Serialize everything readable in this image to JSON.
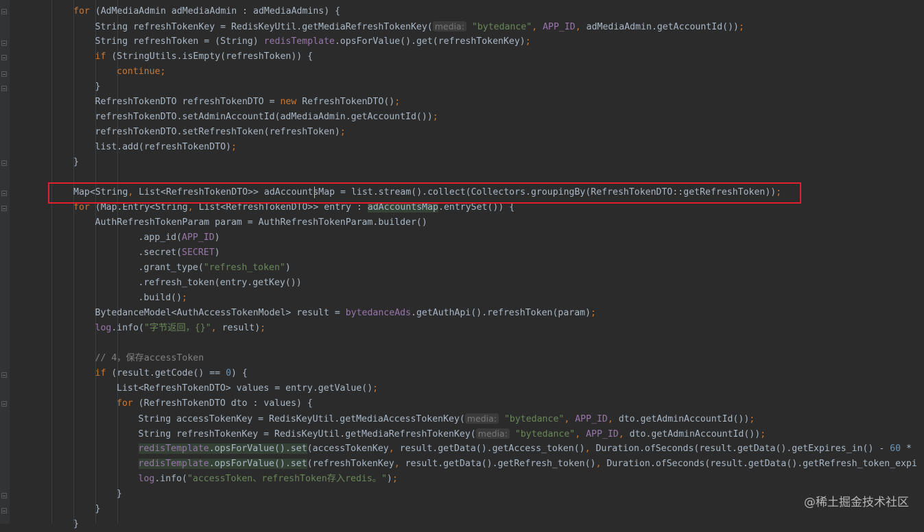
{
  "code_lines": [
    {
      "indent": 2,
      "segs": [
        [
          "kw",
          "for"
        ],
        [
          "plain",
          " (AdMediaAdmin adMediaAdmin : adMediaAdmins) {"
        ]
      ]
    },
    {
      "indent": 3,
      "segs": [
        [
          "plain",
          "String refreshTokenKey = RedisKeyUtil.getMediaRefreshTokenKey("
        ],
        [
          "hint",
          "media:"
        ],
        [
          "plain",
          " "
        ],
        [
          "str",
          "\"bytedance\""
        ],
        [
          "punc",
          ", "
        ],
        [
          "field",
          "APP_ID"
        ],
        [
          "punc",
          ", "
        ],
        [
          "plain",
          "adMediaAdmin.getAccountId())"
        ],
        [
          "punc",
          ";"
        ]
      ]
    },
    {
      "indent": 3,
      "segs": [
        [
          "plain",
          "String refreshToken = (String) "
        ],
        [
          "field",
          "redisTemplate"
        ],
        [
          "plain",
          ".opsForValue().get(refreshTokenKey)"
        ],
        [
          "punc",
          ";"
        ]
      ]
    },
    {
      "indent": 3,
      "segs": [
        [
          "kw",
          "if"
        ],
        [
          "plain",
          " (StringUtils.isEmpty(refreshToken)) {"
        ]
      ]
    },
    {
      "indent": 4,
      "segs": [
        [
          "kw",
          "continue;"
        ]
      ]
    },
    {
      "indent": 3,
      "segs": [
        [
          "plain",
          "}"
        ]
      ]
    },
    {
      "indent": 3,
      "segs": [
        [
          "plain",
          "RefreshTokenDTO refreshTokenDTO = "
        ],
        [
          "kw",
          "new"
        ],
        [
          "plain",
          " RefreshTokenDTO()"
        ],
        [
          "punc",
          ";"
        ]
      ]
    },
    {
      "indent": 3,
      "segs": [
        [
          "plain",
          "refreshTokenDTO.setAdminAccountId(adMediaAdmin.getAccountId())"
        ],
        [
          "punc",
          ";"
        ]
      ]
    },
    {
      "indent": 3,
      "segs": [
        [
          "plain",
          "refreshTokenDTO.setRefreshToken(refreshToken)"
        ],
        [
          "punc",
          ";"
        ]
      ]
    },
    {
      "indent": 3,
      "segs": [
        [
          "plain",
          "list.add(refreshTokenDTO)"
        ],
        [
          "punc",
          ";"
        ]
      ]
    },
    {
      "indent": 2,
      "segs": [
        [
          "plain",
          "}"
        ]
      ]
    },
    {
      "indent": 0,
      "segs": []
    },
    {
      "indent": 2,
      "segs": [
        [
          "plain",
          "Map<String"
        ],
        [
          "punc",
          ", "
        ],
        [
          "plain",
          "List<RefreshTokenDTO>> adAccountsMap = list.stream().collect(Collectors.groupingBy(RefreshTokenDTO::getRefreshToken))"
        ],
        [
          "punc",
          ";"
        ]
      ]
    },
    {
      "indent": 2,
      "segs": [
        [
          "kw",
          "for"
        ],
        [
          "plain",
          " (Map.Entry<String"
        ],
        [
          "punc",
          ", "
        ],
        [
          "plain",
          "List<RefreshTokenDTO>> entry : "
        ],
        [
          "hl",
          "adAccountsMap"
        ],
        [
          "plain",
          ".entrySet()) {"
        ]
      ]
    },
    {
      "indent": 3,
      "segs": [
        [
          "plain",
          "AuthRefreshTokenParam param = AuthRefreshTokenParam.builder()"
        ]
      ]
    },
    {
      "indent": 5,
      "segs": [
        [
          "plain",
          ".app_id("
        ],
        [
          "field",
          "APP_ID"
        ],
        [
          "plain",
          ")"
        ]
      ]
    },
    {
      "indent": 5,
      "segs": [
        [
          "plain",
          ".secret("
        ],
        [
          "field",
          "SECRET"
        ],
        [
          "plain",
          ")"
        ]
      ]
    },
    {
      "indent": 5,
      "segs": [
        [
          "plain",
          ".grant_type("
        ],
        [
          "str",
          "\"refresh_token\""
        ],
        [
          "plain",
          ")"
        ]
      ]
    },
    {
      "indent": 5,
      "segs": [
        [
          "plain",
          ".refresh_token(entry.getKey())"
        ]
      ]
    },
    {
      "indent": 5,
      "segs": [
        [
          "plain",
          ".build()"
        ],
        [
          "punc",
          ";"
        ]
      ]
    },
    {
      "indent": 3,
      "segs": [
        [
          "plain",
          "BytedanceModel<AuthAccessTokenModel> result = "
        ],
        [
          "field",
          "bytedanceAds"
        ],
        [
          "plain",
          ".getAuthApi().refreshToken(param)"
        ],
        [
          "punc",
          ";"
        ]
      ]
    },
    {
      "indent": 3,
      "segs": [
        [
          "field",
          "log"
        ],
        [
          "plain",
          ".info("
        ],
        [
          "str",
          "\"字节返回，{}\""
        ],
        [
          "punc",
          ", "
        ],
        [
          "plain",
          "result)"
        ],
        [
          "punc",
          ";"
        ]
      ]
    },
    {
      "indent": 0,
      "segs": []
    },
    {
      "indent": 3,
      "segs": [
        [
          "cmt",
          "// 4，保存accessToken"
        ]
      ]
    },
    {
      "indent": 3,
      "segs": [
        [
          "kw",
          "if"
        ],
        [
          "plain",
          " (result.getCode() == "
        ],
        [
          "num",
          "0"
        ],
        [
          "plain",
          ") {"
        ]
      ]
    },
    {
      "indent": 4,
      "segs": [
        [
          "plain",
          "List<RefreshTokenDTO> values = entry.getValue()"
        ],
        [
          "punc",
          ";"
        ]
      ]
    },
    {
      "indent": 4,
      "segs": [
        [
          "kw",
          "for"
        ],
        [
          "plain",
          " (RefreshTokenDTO dto : values) {"
        ]
      ]
    },
    {
      "indent": 5,
      "segs": [
        [
          "plain",
          "String accessTokenKey = RedisKeyUtil.getMediaAccessTokenKey("
        ],
        [
          "hint",
          "media:"
        ],
        [
          "plain",
          " "
        ],
        [
          "str",
          "\"bytedance\""
        ],
        [
          "punc",
          ", "
        ],
        [
          "field",
          "APP_ID"
        ],
        [
          "punc",
          ", "
        ],
        [
          "plain",
          "dto.getAdminAccountId())"
        ],
        [
          "punc",
          ";"
        ]
      ]
    },
    {
      "indent": 5,
      "segs": [
        [
          "plain",
          "String refreshTokenKey = RedisKeyUtil.getMediaRefreshTokenKey("
        ],
        [
          "hint",
          "media:"
        ],
        [
          "plain",
          " "
        ],
        [
          "str",
          "\"bytedance\""
        ],
        [
          "punc",
          ", "
        ],
        [
          "field",
          "APP_ID"
        ],
        [
          "punc",
          ", "
        ],
        [
          "plain",
          "dto.getAdminAccountId())"
        ],
        [
          "punc",
          ";"
        ]
      ]
    },
    {
      "indent": 5,
      "segs": [
        [
          "hlf",
          "redisTemplate"
        ],
        [
          "hl",
          ".opsForValue().set"
        ],
        [
          "plain",
          "(accessTokenKey"
        ],
        [
          "punc",
          ", "
        ],
        [
          "plain",
          "result.getData().getAccess_token()"
        ],
        [
          "punc",
          ", "
        ],
        [
          "plain",
          "Duration.ofSeconds(result.getData().getExpires_in() - "
        ],
        [
          "num",
          "60"
        ],
        [
          "plain",
          " *"
        ]
      ]
    },
    {
      "indent": 5,
      "segs": [
        [
          "hlf",
          "redisTemplate"
        ],
        [
          "hl",
          ".opsForValue().set"
        ],
        [
          "plain",
          "(refreshTokenKey"
        ],
        [
          "punc",
          ", "
        ],
        [
          "plain",
          "result.getData().getRefresh_token()"
        ],
        [
          "punc",
          ", "
        ],
        [
          "plain",
          "Duration.ofSeconds(result.getData().getRefresh_token_expi"
        ]
      ]
    },
    {
      "indent": 5,
      "segs": [
        [
          "field",
          "log"
        ],
        [
          "plain",
          ".info("
        ],
        [
          "str",
          "\"accessToken、refreshToken存入redis。\""
        ],
        [
          "plain",
          ")"
        ],
        [
          "punc",
          ";"
        ]
      ]
    },
    {
      "indent": 4,
      "segs": [
        [
          "plain",
          "}"
        ]
      ]
    },
    {
      "indent": 3,
      "segs": [
        [
          "plain",
          "}"
        ]
      ]
    },
    {
      "indent": 2,
      "segs": [
        [
          "plain",
          "}"
        ]
      ]
    }
  ],
  "watermark": "@稀土掘金技术社区",
  "colors": {
    "background": "#2b2b2b",
    "keyword": "#cc7832",
    "text": "#a9b7c6",
    "field": "#9876aa",
    "string": "#6a8759",
    "number": "#6897bb",
    "comment": "#808080",
    "highlight_box": "#e0202a"
  }
}
